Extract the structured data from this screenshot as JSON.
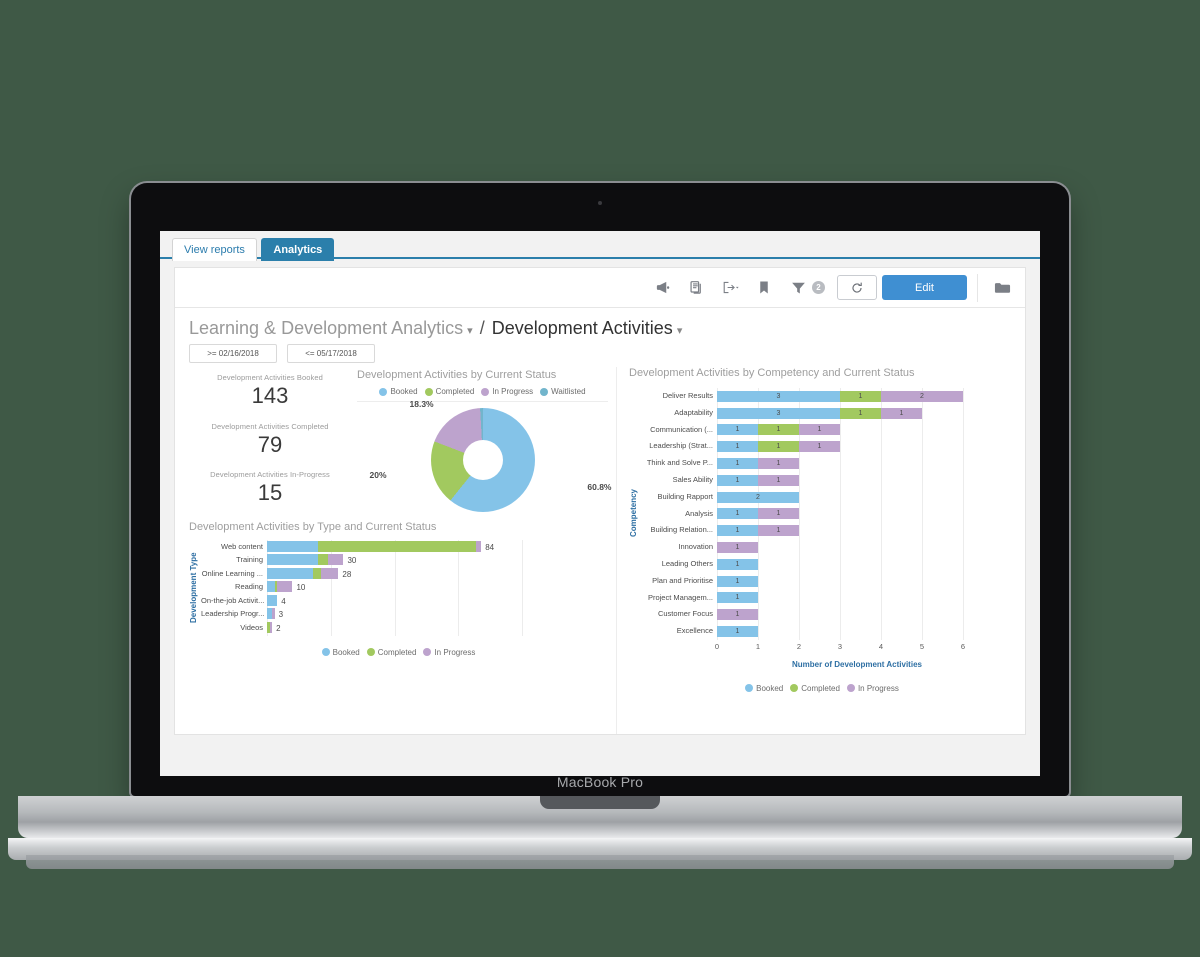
{
  "device": {
    "label": "MacBook Pro"
  },
  "app": {
    "tabs": [
      {
        "label": "View reports",
        "active": false
      },
      {
        "label": "Analytics",
        "active": true
      }
    ]
  },
  "toolbar": {
    "icons": [
      {
        "name": "announcement-icon",
        "glyph": "megaphone"
      },
      {
        "name": "copy-report-icon",
        "glyph": "documents"
      },
      {
        "name": "export-icon",
        "glyph": "export"
      },
      {
        "name": "bookmark-icon",
        "glyph": "bookmark"
      },
      {
        "name": "filter-icon",
        "glyph": "funnel"
      }
    ],
    "filter_badge": "2",
    "refresh_label": "↺",
    "edit_label": "Edit",
    "folder_icon": "folder-icon"
  },
  "header": {
    "breadcrumb_parent": "Learning & Development Analytics",
    "separator": "/",
    "breadcrumb_current": "Development Activities",
    "caret": "▾",
    "filters": [
      {
        "label": ">= 02/16/2018"
      },
      {
        "label": "<= 05/17/2018"
      }
    ]
  },
  "colors": {
    "booked": "#84c3e8",
    "completed": "#a2c95f",
    "in_progress": "#bda3cd",
    "waitlisted": "#72b5cc",
    "accent_blue": "#2e6fa3",
    "edit_button": "#3f8fd2",
    "tab_active": "#2b7fab"
  },
  "kpis": [
    {
      "label": "Development Activities Booked",
      "value": "143"
    },
    {
      "label": "Development Activities Completed",
      "value": "79"
    },
    {
      "label": "Development Activities In-Progress",
      "value": "15"
    }
  ],
  "chart_data": [
    {
      "id": "status-donut",
      "type": "pie",
      "title": "Development Activities by Current Status",
      "legend_position": "top",
      "legend": [
        "Booked",
        "Completed",
        "In Progress",
        "Waitlisted"
      ],
      "categories": [
        "Booked",
        "Completed",
        "In Progress",
        "Waitlisted"
      ],
      "values": [
        60.8,
        20,
        18.3,
        0.9
      ],
      "labels": [
        "60.8%",
        "20%",
        "18.3%",
        ""
      ],
      "colors": [
        "#84c3e8",
        "#a2c95f",
        "#bda3cd",
        "#72b5cc"
      ],
      "xlabel": "",
      "ylabel": ""
    },
    {
      "id": "type-bars",
      "type": "bar",
      "orientation": "horizontal",
      "stacked": true,
      "title": "Development Activities by Type and Current Status",
      "ylabel": "Development Type",
      "xlabel": "",
      "legend_position": "bottom",
      "legend": [
        "Booked",
        "Completed",
        "In Progress"
      ],
      "colors": [
        "#84c3e8",
        "#a2c95f",
        "#bda3cd"
      ],
      "xlim": [
        0,
        100
      ],
      "grid": true,
      "categories": [
        "Web content",
        "Training",
        "Online Learning ...",
        "Reading",
        "On-the-job Activit...",
        "Leadership Progr...",
        "Videos"
      ],
      "totals": [
        "84",
        "30",
        "28",
        "10",
        "4",
        "3",
        "2"
      ],
      "series": [
        {
          "name": "Booked",
          "values": [
            20,
            20,
            18,
            3,
            4,
            2,
            0
          ]
        },
        {
          "name": "Completed",
          "values": [
            62,
            4,
            3,
            1,
            0,
            0,
            1
          ]
        },
        {
          "name": "In Progress",
          "values": [
            2,
            6,
            7,
            6,
            0,
            1,
            1
          ]
        }
      ]
    },
    {
      "id": "competency-bars",
      "type": "bar",
      "orientation": "horizontal",
      "stacked": true,
      "title": "Development Activities by Competency and Current Status",
      "ylabel": "Competency",
      "xlabel": "Number of Development Activities",
      "legend_position": "bottom",
      "legend": [
        "Booked",
        "Completed",
        "In Progress"
      ],
      "colors": [
        "#84c3e8",
        "#a2c95f",
        "#bda3cd"
      ],
      "xlim": [
        0,
        6.8
      ],
      "xticks": [
        "0",
        "1",
        "2",
        "3",
        "4",
        "5",
        "6"
      ],
      "grid": true,
      "categories": [
        "Deliver Results",
        "Adaptability",
        "Communication (...",
        "Leadership (Strat...",
        "Think and Solve P...",
        "Sales Ability",
        "Building Rapport",
        "Analysis",
        "Building Relation...",
        "Innovation",
        "Leading Others",
        "Plan and Prioritise",
        "Project Managem...",
        "Customer Focus",
        "Excellence"
      ],
      "series": [
        {
          "name": "Booked",
          "values": [
            3,
            3,
            1,
            1,
            1,
            1,
            2,
            1,
            1,
            0,
            1,
            1,
            1,
            0,
            1
          ]
        },
        {
          "name": "Completed",
          "values": [
            1,
            1,
            1,
            1,
            0,
            0,
            0,
            0,
            0,
            0,
            0,
            0,
            0,
            0,
            0
          ]
        },
        {
          "name": "In Progress",
          "values": [
            2,
            1,
            1,
            1,
            1,
            1,
            0,
            1,
            1,
            1,
            0,
            0,
            0,
            1,
            0
          ]
        }
      ]
    }
  ],
  "legends": {
    "type_chart": [
      "Booked",
      "Completed",
      "In Progress"
    ],
    "competency_chart": [
      "Booked",
      "Completed",
      "In Progress"
    ]
  }
}
